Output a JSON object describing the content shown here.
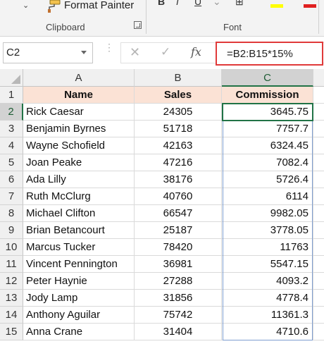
{
  "ribbon": {
    "format_painter_label": "Format Painter",
    "format_painter_icon": "paintbrush-icon",
    "clipboard_group_label": "Clipboard",
    "font_group_label": "Font",
    "colors": {
      "highlight": "#ffff00",
      "font_color": "#e02020"
    }
  },
  "formula_bar": {
    "name_box_value": "C2",
    "cancel_symbol": "✕",
    "enter_symbol": "✓",
    "fx_symbol": "fx",
    "formula": "=B2:B15*15%",
    "highlight_color": "#e03a3a"
  },
  "grid": {
    "columns": [
      "A",
      "B",
      "C"
    ],
    "selected_column": "C",
    "selected_cell": "C2",
    "header_row": {
      "row": "1",
      "name": "Name",
      "sales": "Sales",
      "commission": "Commission"
    },
    "rows": [
      {
        "row": "2",
        "name": "Rick Caesar",
        "sales": "24305",
        "commission": "3645.75"
      },
      {
        "row": "3",
        "name": "Benjamin Byrnes",
        "sales": "51718",
        "commission": "7757.7"
      },
      {
        "row": "4",
        "name": "Wayne Schofield",
        "sales": "42163",
        "commission": "6324.45"
      },
      {
        "row": "5",
        "name": "Joan Peake",
        "sales": "47216",
        "commission": "7082.4"
      },
      {
        "row": "6",
        "name": "Ada Lilly",
        "sales": "38176",
        "commission": "5726.4"
      },
      {
        "row": "7",
        "name": "Ruth McClurg",
        "sales": "40760",
        "commission": "6114"
      },
      {
        "row": "8",
        "name": "Michael Clifton",
        "sales": "66547",
        "commission": "9982.05"
      },
      {
        "row": "9",
        "name": "Brian Betancourt",
        "sales": "25187",
        "commission": "3778.05"
      },
      {
        "row": "10",
        "name": "Marcus Tucker",
        "sales": "78420",
        "commission": "11763"
      },
      {
        "row": "11",
        "name": "Vincent Pennington",
        "sales": "36981",
        "commission": "5547.15"
      },
      {
        "row": "12",
        "name": "Peter Haynie",
        "sales": "27288",
        "commission": "4093.2"
      },
      {
        "row": "13",
        "name": "Jody Lamp",
        "sales": "31856",
        "commission": "4778.4"
      },
      {
        "row": "14",
        "name": "Anthony Aguilar",
        "sales": "75742",
        "commission": "11361.3"
      },
      {
        "row": "15",
        "name": "Anna Crane",
        "sales": "31404",
        "commission": "4710.6"
      }
    ]
  }
}
